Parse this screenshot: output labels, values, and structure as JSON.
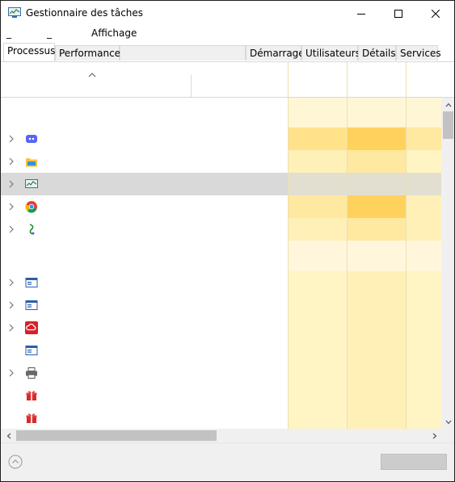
{
  "window": {
    "title": "Gestionnaire des tâches"
  },
  "menubar": {
    "items": [
      "_",
      "_",
      "Affichage"
    ]
  },
  "tabs": [
    "Processus",
    "Performance",
    "Démarrage",
    "Utilisateurs",
    "Détails",
    "Services"
  ],
  "active_tab": "Processus",
  "colors": {
    "heat_light": "#fff4c4",
    "heat_medium": "#ffe8a0",
    "heat_strong": "#ffd460",
    "selected_row": "#d9d9d9"
  },
  "rows": [
    {
      "icon": "blank",
      "expandable": false
    },
    {
      "icon": "discord-icon",
      "expandable": true
    },
    {
      "icon": "file-explorer-icon",
      "expandable": true
    },
    {
      "icon": "task-manager-icon",
      "expandable": true,
      "selected": true
    },
    {
      "icon": "chrome-icon",
      "expandable": true
    },
    {
      "icon": "app-icon",
      "expandable": true
    },
    {
      "icon": "blank",
      "expandable": false
    },
    {
      "icon": "window-app-icon",
      "expandable": true
    },
    {
      "icon": "window-app-icon",
      "expandable": true
    },
    {
      "icon": "creative-cloud-icon",
      "expandable": true
    },
    {
      "icon": "window-app-icon",
      "expandable": false
    },
    {
      "icon": "printer-icon",
      "expandable": true
    },
    {
      "icon": "gift-icon",
      "expandable": false
    },
    {
      "icon": "gift-icon",
      "expandable": false
    }
  ]
}
